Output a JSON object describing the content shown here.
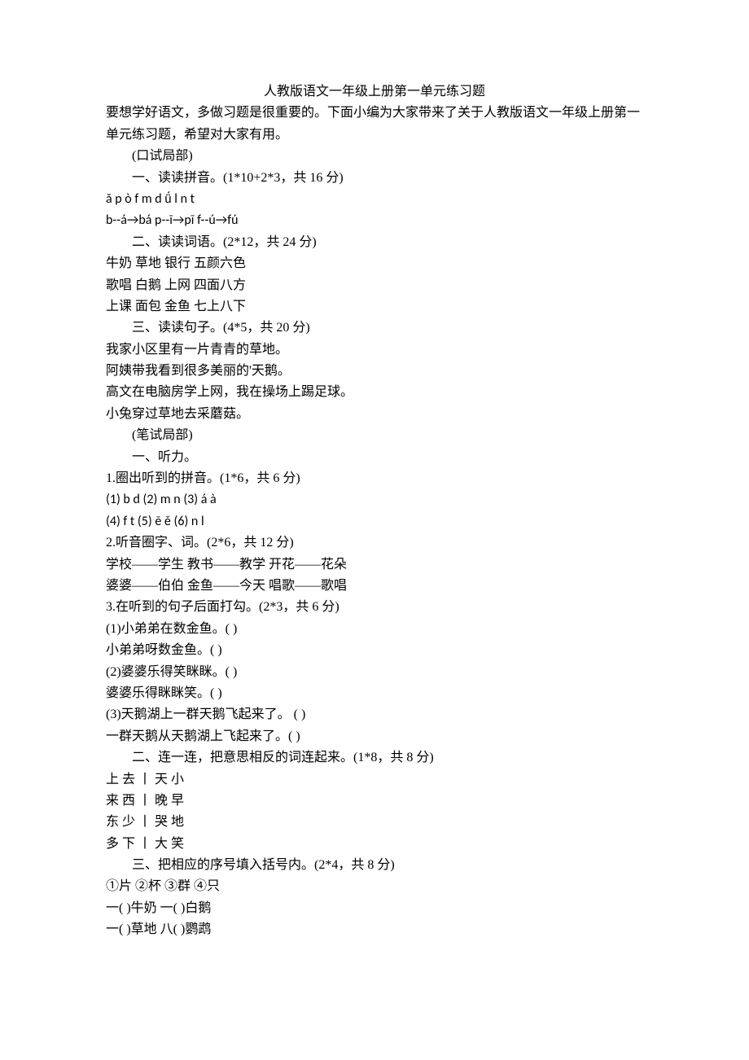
{
  "title": "人教版语文一年级上册第一单元练习题",
  "intro": "要想学好语文，多做习题是很重要的。下面小编为大家带来了关于人教版语文一年级上册第一单元练习题，希望对大家有用。",
  "oral": {
    "header": "(口试局部)",
    "sec1": {
      "heading": "一、读读拼音。(1*10+2*3，共 16 分)",
      "line1": "ǎ p ò f m d ǘ l n t",
      "line2": "b--á→bá p--ī→pī f--ú→fú"
    },
    "sec2": {
      "heading": "二、读读词语。(2*12，共 24 分)",
      "line1": "牛奶  草地  银行  五颜六色",
      "line2": "歌唱  白鹅  上网  四面八方",
      "line3": "上课  面包  金鱼  七上八下"
    },
    "sec3": {
      "heading": "三、读读句子。(4*5，共 20 分)",
      "line1": "我家小区里有一片青青的草地。",
      "line2": "阿姨带我看到很多美丽的'天鹅。",
      "line3": "高文在电脑房学上网，我在操场上踢足球。",
      "line4": "小兔穿过草地去采蘑菇。"
    }
  },
  "written": {
    "header": "(笔试局部)",
    "sec1": {
      "heading": "一、听力。",
      "q1": {
        "title": "1.圈出听到的拼音。(1*6，共 6 分)",
        "line1": "(1) b d (2) m n (3) á à",
        "line2": "(4) f t (5) ē ě (6) n l"
      },
      "q2": {
        "title": "2.听音圈字、词。(2*6，共 12 分)",
        "line1": "学校——学生  教书——教学  开花——花朵",
        "line2": "婆婆——伯伯  金鱼——今天  唱歌——歌唱"
      },
      "q3": {
        "title": "3.在听到的句子后面打勾。(2*3，共 6 分)",
        "p1a": "(1)小弟弟在数金鱼。( )",
        "p1b": "小弟弟呀数金鱼。( )",
        "p2a": "(2)婆婆乐得笑眯眯。( )",
        "p2b": "婆婆乐得眯眯笑。( )",
        "p3a": "(3)天鹅湖上一群天鹅飞起来了。 ( )",
        "p3b": "一群天鹅从天鹅湖上飞起来了。( )"
      }
    },
    "sec2": {
      "heading": "二、连一连，把意思相反的词连起来。(1*8，共 8 分)",
      "line1": "上  去  丨  天  小",
      "line2": "来  西  丨  晚  早",
      "line3": "东  少  丨  哭  地",
      "line4": "多  下  丨  大  笑"
    },
    "sec3": {
      "heading": "三、把相应的序号填入括号内。(2*4，共 8 分)",
      "line1": "①片  ②杯  ③群  ④只",
      "line2": "一( )牛奶  一( )白鹅",
      "line3": "一( )草地  八( )鹦鹉"
    }
  }
}
